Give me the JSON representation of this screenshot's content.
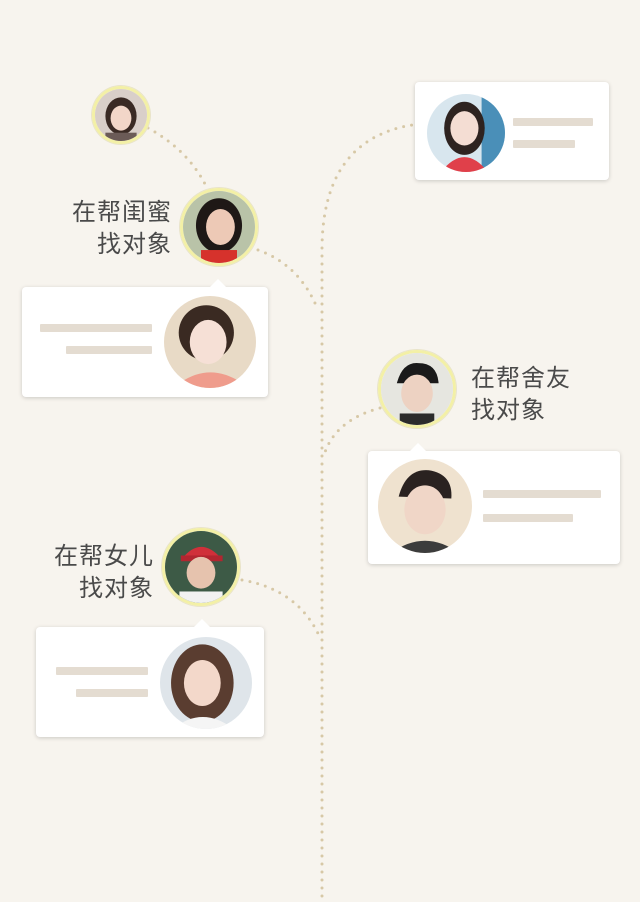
{
  "colors": {
    "background": "#f7f4ee",
    "dots": "#d7c8a6",
    "avatar_ring": "#f3f0a6",
    "placeholder_bar": "#e4dcd1",
    "card": "#ffffff"
  },
  "entries": [
    {
      "id": "top-right-profile",
      "has_label": false
    },
    {
      "id": "friend",
      "label_line1": "在帮闺蜜",
      "label_line2": "找对象"
    },
    {
      "id": "roommate",
      "label_line1": "在帮舍友",
      "label_line2": "找对象"
    },
    {
      "id": "daughter",
      "label_line1": "在帮女儿",
      "label_line2": "找对象"
    }
  ],
  "icons": {
    "avatar": "person-avatar-icon"
  }
}
